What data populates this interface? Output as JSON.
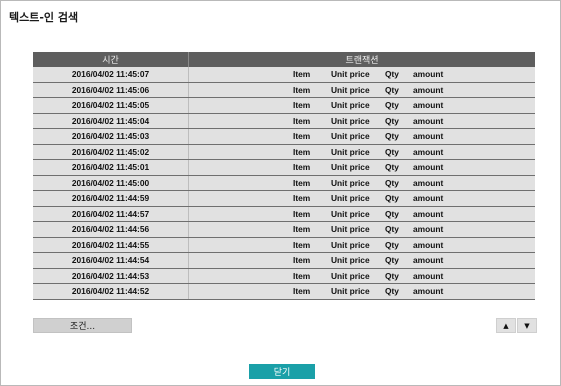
{
  "dialog": {
    "title": "텍스트-인 검색"
  },
  "table": {
    "headers": {
      "time": "시간",
      "transaction": "트랜잭션"
    },
    "rows": [
      {
        "time": "2016/04/02  11:45:07",
        "item": "Item",
        "price": "Unit price",
        "qty": "Qty",
        "amount": "amount"
      },
      {
        "time": "2016/04/02  11:45:06",
        "item": "Item",
        "price": "Unit price",
        "qty": "Qty",
        "amount": "amount"
      },
      {
        "time": "2016/04/02  11:45:05",
        "item": "Item",
        "price": "Unit price",
        "qty": "Qty",
        "amount": "amount"
      },
      {
        "time": "2016/04/02  11:45:04",
        "item": "Item",
        "price": "Unit price",
        "qty": "Qty",
        "amount": "amount"
      },
      {
        "time": "2016/04/02  11:45:03",
        "item": "Item",
        "price": "Unit price",
        "qty": "Qty",
        "amount": "amount"
      },
      {
        "time": "2016/04/02  11:45:02",
        "item": "Item",
        "price": "Unit price",
        "qty": "Qty",
        "amount": "amount"
      },
      {
        "time": "2016/04/02  11:45:01",
        "item": "Item",
        "price": "Unit price",
        "qty": "Qty",
        "amount": "amount"
      },
      {
        "time": "2016/04/02  11:45:00",
        "item": "Item",
        "price": "Unit price",
        "qty": "Qty",
        "amount": "amount"
      },
      {
        "time": "2016/04/02  11:44:59",
        "item": "Item",
        "price": "Unit price",
        "qty": "Qty",
        "amount": "amount"
      },
      {
        "time": "2016/04/02  11:44:57",
        "item": "Item",
        "price": "Unit price",
        "qty": "Qty",
        "amount": "amount"
      },
      {
        "time": "2016/04/02  11:44:56",
        "item": "Item",
        "price": "Unit price",
        "qty": "Qty",
        "amount": "amount"
      },
      {
        "time": "2016/04/02  11:44:55",
        "item": "Item",
        "price": "Unit price",
        "qty": "Qty",
        "amount": "amount"
      },
      {
        "time": "2016/04/02  11:44:54",
        "item": "Item",
        "price": "Unit price",
        "qty": "Qty",
        "amount": "amount"
      },
      {
        "time": "2016/04/02  11:44:53",
        "item": "Item",
        "price": "Unit price",
        "qty": "Qty",
        "amount": "amount"
      },
      {
        "time": "2016/04/02  11:44:52",
        "item": "Item",
        "price": "Unit price",
        "qty": "Qty",
        "amount": "amount"
      }
    ]
  },
  "controls": {
    "condition_label": "조건...",
    "scroll_up_icon": "arrow-up-icon",
    "scroll_down_icon": "arrow-down-icon",
    "scroll_up_glyph": "▲",
    "scroll_down_glyph": "▼",
    "close_label": "닫기"
  },
  "colors": {
    "header_bg": "#5e5e5e",
    "row_bg": "#e1e1e1",
    "close_button_bg": "#1aa0a8"
  }
}
